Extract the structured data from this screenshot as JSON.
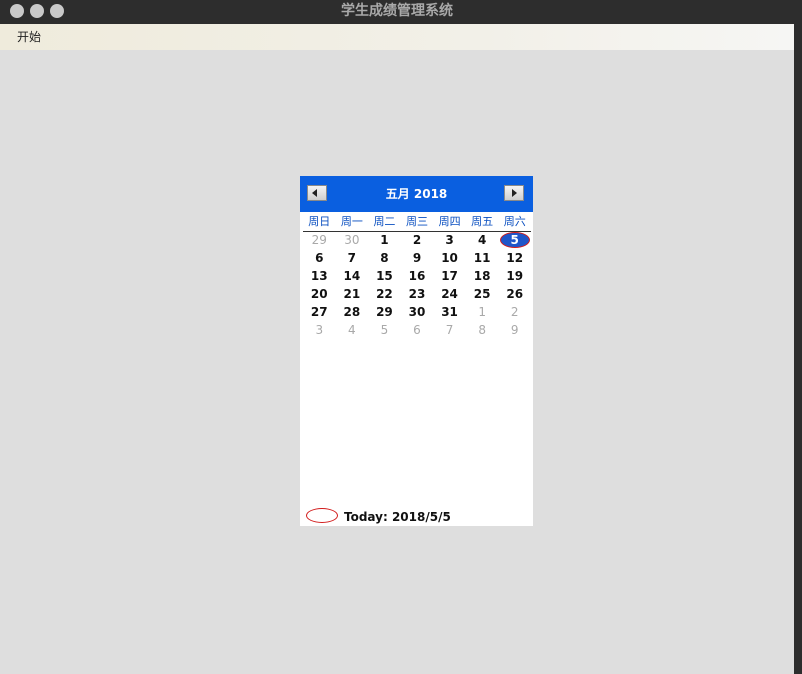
{
  "window": {
    "title": "学生成绩管理系统"
  },
  "menubar": {
    "items": [
      "开始"
    ]
  },
  "calendar": {
    "month_title": "五月 2018",
    "weekdays": [
      "周日",
      "周一",
      "周二",
      "周三",
      "周四",
      "周五",
      "周六"
    ],
    "days": [
      {
        "d": "29",
        "other": true
      },
      {
        "d": "30",
        "other": true
      },
      {
        "d": "1"
      },
      {
        "d": "2"
      },
      {
        "d": "3"
      },
      {
        "d": "4"
      },
      {
        "d": "5",
        "selected": true
      },
      {
        "d": "6"
      },
      {
        "d": "7"
      },
      {
        "d": "8"
      },
      {
        "d": "9"
      },
      {
        "d": "10"
      },
      {
        "d": "11"
      },
      {
        "d": "12"
      },
      {
        "d": "13"
      },
      {
        "d": "14"
      },
      {
        "d": "15"
      },
      {
        "d": "16"
      },
      {
        "d": "17"
      },
      {
        "d": "18"
      },
      {
        "d": "19"
      },
      {
        "d": "20"
      },
      {
        "d": "21"
      },
      {
        "d": "22"
      },
      {
        "d": "23"
      },
      {
        "d": "24"
      },
      {
        "d": "25"
      },
      {
        "d": "26"
      },
      {
        "d": "27"
      },
      {
        "d": "28"
      },
      {
        "d": "29"
      },
      {
        "d": "30"
      },
      {
        "d": "31"
      },
      {
        "d": "1",
        "other": true
      },
      {
        "d": "2",
        "other": true
      },
      {
        "d": "3",
        "other": true
      },
      {
        "d": "4",
        "other": true
      },
      {
        "d": "5",
        "other": true
      },
      {
        "d": "6",
        "other": true
      },
      {
        "d": "7",
        "other": true
      },
      {
        "d": "8",
        "other": true
      },
      {
        "d": "9",
        "other": true
      }
    ],
    "today_text": "Today: 2018/5/5",
    "prev_icon": "left-arrow-icon",
    "next_icon": "right-arrow-icon"
  },
  "colors": {
    "header_bg": "#0a5fe0",
    "selected_bg": "#1f56c9",
    "today_mark": "#d21c1c",
    "desktop_bg": "#dedede"
  }
}
